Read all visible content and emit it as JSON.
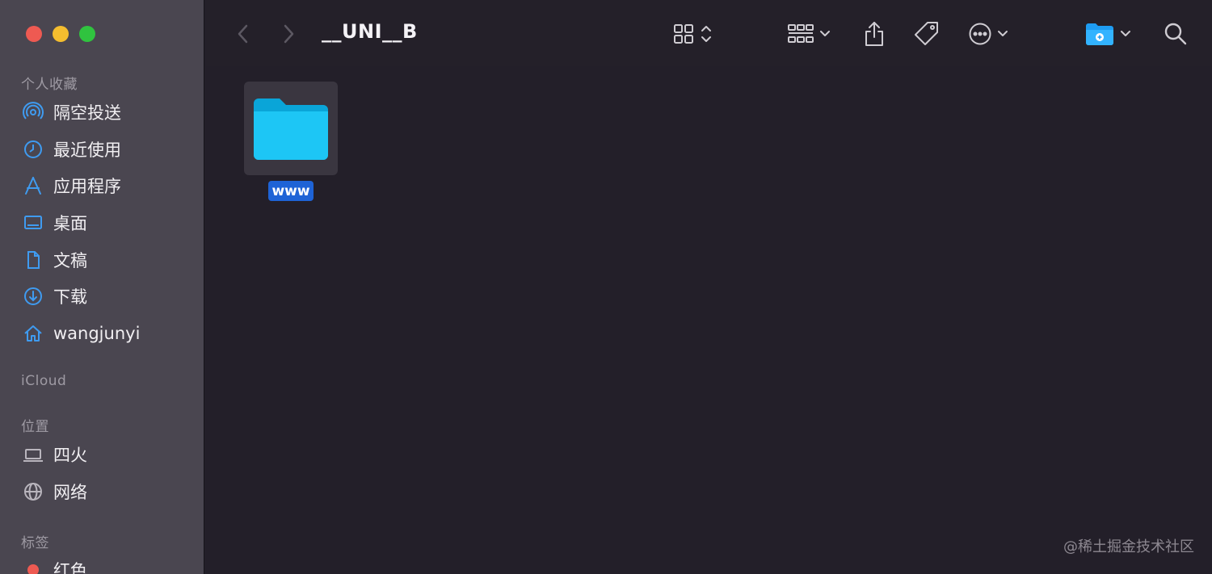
{
  "window": {
    "title": "__UNI__B"
  },
  "sidebar": {
    "favorites_title": "个人收藏",
    "favorites": [
      {
        "label": "隔空投送",
        "icon": "airdrop-icon"
      },
      {
        "label": "最近使用",
        "icon": "clock-icon"
      },
      {
        "label": "应用程序",
        "icon": "apps-icon"
      },
      {
        "label": "桌面",
        "icon": "desktop-icon"
      },
      {
        "label": "文稿",
        "icon": "document-icon"
      },
      {
        "label": "下载",
        "icon": "download-icon"
      },
      {
        "label": "wangjunyi",
        "icon": "home-icon"
      }
    ],
    "icloud_title": "iCloud",
    "locations_title": "位置",
    "locations": [
      {
        "label": "四火",
        "icon": "laptop-icon"
      },
      {
        "label": "网络",
        "icon": "globe-icon"
      }
    ],
    "tags_title": "标签",
    "tags": [
      {
        "label": "红色",
        "color": "#ee5a52"
      }
    ]
  },
  "content": {
    "items": [
      {
        "name": "www",
        "type": "folder",
        "color": "#1dc6f5"
      }
    ]
  },
  "watermark": "@稀土掘金技术社区",
  "colors": {
    "accent": "#1e63d6",
    "folder": "#1dc6f5",
    "sidebar_icon": "#3f9bf0"
  }
}
